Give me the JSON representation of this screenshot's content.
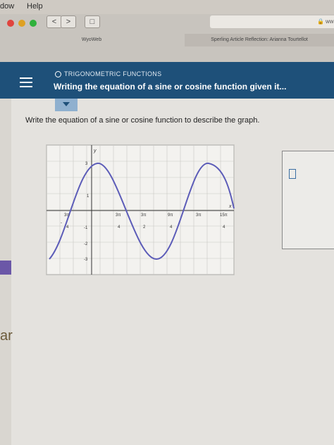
{
  "menubar": {
    "items": [
      "dow",
      "Help"
    ]
  },
  "browser": {
    "nav_back": "<",
    "nav_forward": ">",
    "url_fragment": "ww",
    "tabs": [
      "WyoWeb",
      "Sperling Article Reflection: Arianna Tourtellot"
    ]
  },
  "header": {
    "section": "TRIGONOMETRIC FUNCTIONS",
    "title": "Writing the equation of a sine or cosine function given it..."
  },
  "question": {
    "prompt": "Write the equation of a sine or cosine function to describe the graph."
  },
  "graph_labels": {
    "y_axis": "y",
    "x_axis": "x",
    "x_ticks": [
      {
        "num": "3π",
        "den": "4",
        "neg": true
      },
      {
        "num": "3π",
        "den": "4"
      },
      {
        "num": "3π",
        "den": "2"
      },
      {
        "num": "9π",
        "den": "4"
      },
      {
        "num": "3π",
        "den": ""
      },
      {
        "num": "15π",
        "den": "4"
      }
    ],
    "y_ticks": [
      "3",
      "1",
      "-1",
      "-2",
      "-3"
    ],
    "neg_sign": "-"
  },
  "sidebar": {
    "cut_word": "ar"
  },
  "colors": {
    "header": "#1e5079",
    "curve": "#5c5cb8",
    "accent": "#8fb0cf"
  }
}
